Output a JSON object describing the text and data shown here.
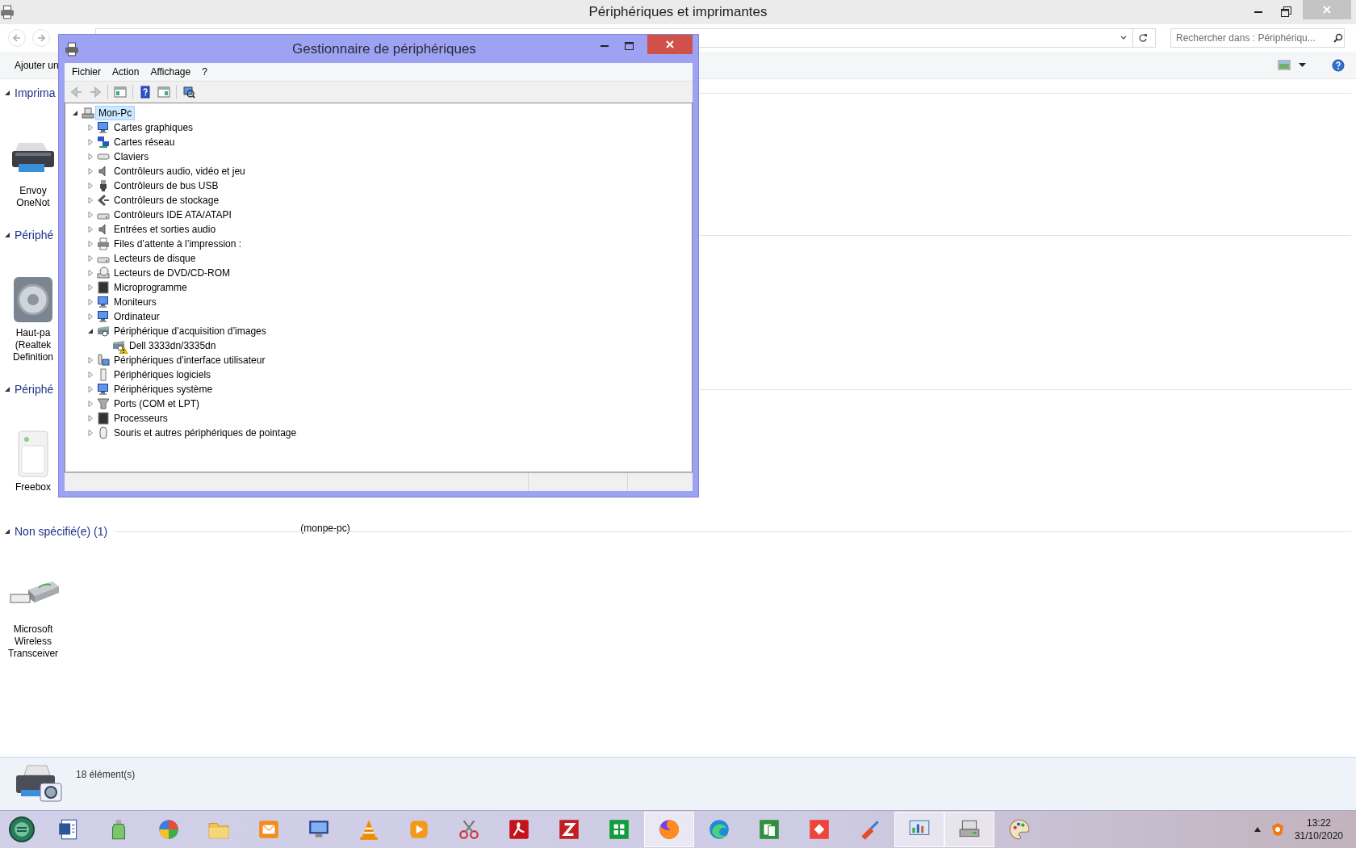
{
  "explorer": {
    "title": "Périphériques et imprimantes",
    "nav": [
      {
        "disabled": true
      },
      {
        "disabled": true
      }
    ],
    "search": {
      "placeholder": "Rechercher dans : Périphériqu..."
    },
    "command": "Ajouter un",
    "groups": [
      {
        "title": "Imprima",
        "expanded": true,
        "devices": [
          {
            "lines": [
              "Envoy",
              "OneNot"
            ],
            "covered": false
          }
        ]
      },
      {
        "title": "Périphé",
        "expanded": true,
        "devices": [
          {
            "lines": [
              "Haut-pa",
              "(Realtek",
              "Definition"
            ],
            "covered": false
          }
        ]
      },
      {
        "title": "Périphé",
        "expanded": true,
        "devices": [
          {
            "lines": [
              "Freebox"
            ],
            "covered": false
          },
          {
            "lines": [
              "(monpe-pc)"
            ],
            "covered": true
          }
        ]
      },
      {
        "title": "Non spécifié(e) (1)",
        "expanded": true,
        "devices": [
          {
            "lines": [
              "Microsoft",
              "Wireless",
              "Transceiver"
            ],
            "covered": false
          }
        ]
      }
    ],
    "details": {
      "count": "18 élément(s)"
    }
  },
  "dialog": {
    "title": "Gestionnaire de périphériques",
    "menu": [
      "Fichier",
      "Action",
      "Affichage",
      "?"
    ],
    "toolbar": [
      {
        "disabled": true
      },
      {
        "disabled": true
      },
      {
        "disabled": false
      },
      {
        "disabled": false
      },
      {
        "disabled": false
      },
      {
        "disabled": false
      }
    ],
    "tree": [
      {
        "label": "Mon-Pc",
        "selected": true,
        "expanded": true,
        "children": [
          {
            "label": "Cartes graphiques",
            "selected": false,
            "expanded": false
          },
          {
            "label": "Cartes réseau",
            "selected": false,
            "expanded": false
          },
          {
            "label": "Claviers",
            "selected": false,
            "expanded": false
          },
          {
            "label": "Contrôleurs audio, vidéo et jeu",
            "selected": false,
            "expanded": false
          },
          {
            "label": "Contrôleurs de bus USB",
            "selected": false,
            "expanded": false
          },
          {
            "label": "Contrôleurs de stockage",
            "selected": false,
            "expanded": false
          },
          {
            "label": "Contrôleurs IDE ATA/ATAPI",
            "selected": false,
            "expanded": false
          },
          {
            "label": "Entrées et sorties audio",
            "selected": false,
            "expanded": false
          },
          {
            "label": "Files d’attente à l’impression :",
            "selected": false,
            "expanded": false
          },
          {
            "label": "Lecteurs de disque",
            "selected": false,
            "expanded": false
          },
          {
            "label": "Lecteurs de DVD/CD-ROM",
            "selected": false,
            "expanded": false
          },
          {
            "label": "Microprogramme",
            "selected": false,
            "expanded": false
          },
          {
            "label": "Moniteurs",
            "selected": false,
            "expanded": false
          },
          {
            "label": "Ordinateur",
            "selected": false,
            "expanded": false
          },
          {
            "label": "Périphérique d’acquisition d’images",
            "selected": false,
            "expanded": true,
            "children": [
              {
                "label": "Dell 3333dn/3335dn",
                "selected": false,
                "warning": true
              }
            ]
          },
          {
            "label": "Périphériques d’interface utilisateur",
            "selected": false,
            "expanded": false
          },
          {
            "label": "Périphériques logiciels",
            "selected": false,
            "expanded": false
          },
          {
            "label": "Périphériques système",
            "selected": false,
            "expanded": false
          },
          {
            "label": "Ports (COM et LPT)",
            "selected": false,
            "expanded": false
          },
          {
            "label": "Processeurs",
            "selected": false,
            "expanded": false
          },
          {
            "label": "Souris et autres périphériques de pointage",
            "selected": false,
            "expanded": false
          }
        ]
      }
    ]
  },
  "taskbar": {
    "apps": [
      {
        "active": false
      },
      {
        "active": false
      },
      {
        "active": false
      },
      {
        "active": false
      },
      {
        "active": false
      },
      {
        "active": false
      },
      {
        "active": false
      },
      {
        "active": false
      },
      {
        "active": false
      },
      {
        "active": false
      },
      {
        "active": false
      },
      {
        "active": false
      },
      {
        "active": true
      },
      {
        "active": false
      },
      {
        "active": false
      },
      {
        "active": false
      },
      {
        "active": false
      },
      {
        "active": true
      },
      {
        "active": true
      },
      {
        "active": false
      }
    ],
    "clock": {
      "time": "13:22",
      "date": "31/10/2020"
    }
  }
}
